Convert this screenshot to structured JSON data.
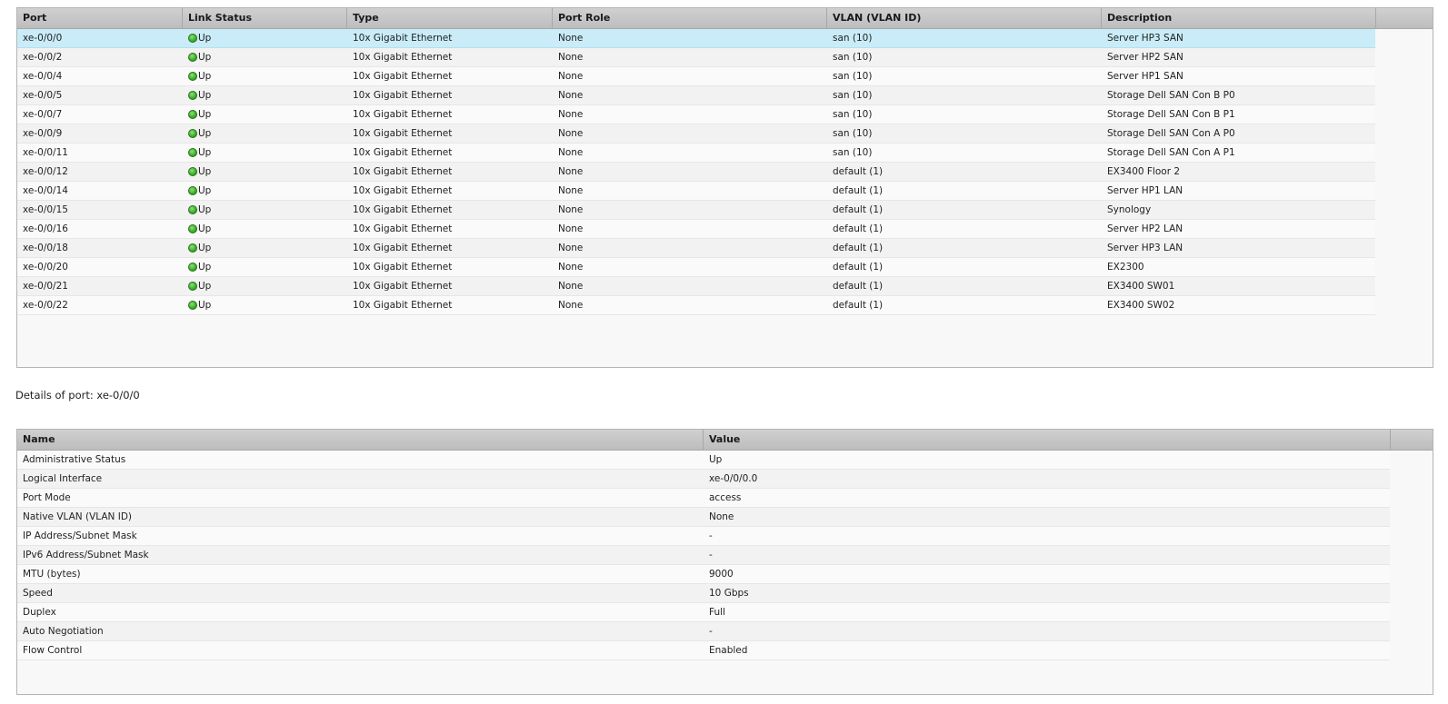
{
  "ports_table": {
    "columns": [
      "Port",
      "Link Status",
      "Type",
      "Port Role",
      "VLAN (VLAN ID)",
      "Description"
    ],
    "rows": [
      {
        "port": "xe-0/0/0",
        "status": "Up",
        "type": "10x Gigabit Ethernet",
        "role": "None",
        "vlan": "san (10)",
        "description": "Server HP3 SAN"
      },
      {
        "port": "xe-0/0/2",
        "status": "Up",
        "type": "10x Gigabit Ethernet",
        "role": "None",
        "vlan": "san (10)",
        "description": "Server HP2 SAN"
      },
      {
        "port": "xe-0/0/4",
        "status": "Up",
        "type": "10x Gigabit Ethernet",
        "role": "None",
        "vlan": "san (10)",
        "description": "Server HP1 SAN"
      },
      {
        "port": "xe-0/0/5",
        "status": "Up",
        "type": "10x Gigabit Ethernet",
        "role": "None",
        "vlan": "san (10)",
        "description": "Storage Dell SAN Con B P0"
      },
      {
        "port": "xe-0/0/7",
        "status": "Up",
        "type": "10x Gigabit Ethernet",
        "role": "None",
        "vlan": "san (10)",
        "description": "Storage Dell SAN Con B P1"
      },
      {
        "port": "xe-0/0/9",
        "status": "Up",
        "type": "10x Gigabit Ethernet",
        "role": "None",
        "vlan": "san (10)",
        "description": "Storage Dell SAN Con A P0"
      },
      {
        "port": "xe-0/0/11",
        "status": "Up",
        "type": "10x Gigabit Ethernet",
        "role": "None",
        "vlan": "san (10)",
        "description": "Storage Dell SAN Con A P1"
      },
      {
        "port": "xe-0/0/12",
        "status": "Up",
        "type": "10x Gigabit Ethernet",
        "role": "None",
        "vlan": "default (1)",
        "description": "EX3400 Floor 2"
      },
      {
        "port": "xe-0/0/14",
        "status": "Up",
        "type": "10x Gigabit Ethernet",
        "role": "None",
        "vlan": "default (1)",
        "description": "Server HP1 LAN"
      },
      {
        "port": "xe-0/0/15",
        "status": "Up",
        "type": "10x Gigabit Ethernet",
        "role": "None",
        "vlan": "default (1)",
        "description": "Synology"
      },
      {
        "port": "xe-0/0/16",
        "status": "Up",
        "type": "10x Gigabit Ethernet",
        "role": "None",
        "vlan": "default (1)",
        "description": "Server HP2 LAN"
      },
      {
        "port": "xe-0/0/18",
        "status": "Up",
        "type": "10x Gigabit Ethernet",
        "role": "None",
        "vlan": "default (1)",
        "description": "Server HP3 LAN"
      },
      {
        "port": "xe-0/0/20",
        "status": "Up",
        "type": "10x Gigabit Ethernet",
        "role": "None",
        "vlan": "default (1)",
        "description": "EX2300"
      },
      {
        "port": "xe-0/0/21",
        "status": "Up",
        "type": "10x Gigabit Ethernet",
        "role": "None",
        "vlan": "default (1)",
        "description": "EX3400 SW01"
      },
      {
        "port": "xe-0/0/22",
        "status": "Up",
        "type": "10x Gigabit Ethernet",
        "role": "None",
        "vlan": "default (1)",
        "description": "EX3400 SW02"
      }
    ],
    "selected_row": 0,
    "status_icon": "status-up-green-dot-icon",
    "colors": {
      "selected_row": "#c9ecf8",
      "header": "#c4c4c4",
      "status_up": "#3cb32a"
    }
  },
  "details": {
    "caption": "Details of port: xe-0/0/0",
    "columns": [
      "Name",
      "Value"
    ],
    "rows": [
      {
        "name": "Administrative Status",
        "value": "Up"
      },
      {
        "name": "Logical Interface",
        "value": "xe-0/0/0.0"
      },
      {
        "name": "Port Mode",
        "value": "access"
      },
      {
        "name": "Native VLAN (VLAN ID)",
        "value": "None"
      },
      {
        "name": "IP Address/Subnet Mask",
        "value": "-"
      },
      {
        "name": "IPv6 Address/Subnet Mask",
        "value": "-"
      },
      {
        "name": "MTU (bytes)",
        "value": "9000"
      },
      {
        "name": "Speed",
        "value": "10 Gbps"
      },
      {
        "name": "Duplex",
        "value": "Full"
      },
      {
        "name": "Auto Negotiation",
        "value": "-"
      },
      {
        "name": "Flow Control",
        "value": "Enabled"
      }
    ]
  }
}
